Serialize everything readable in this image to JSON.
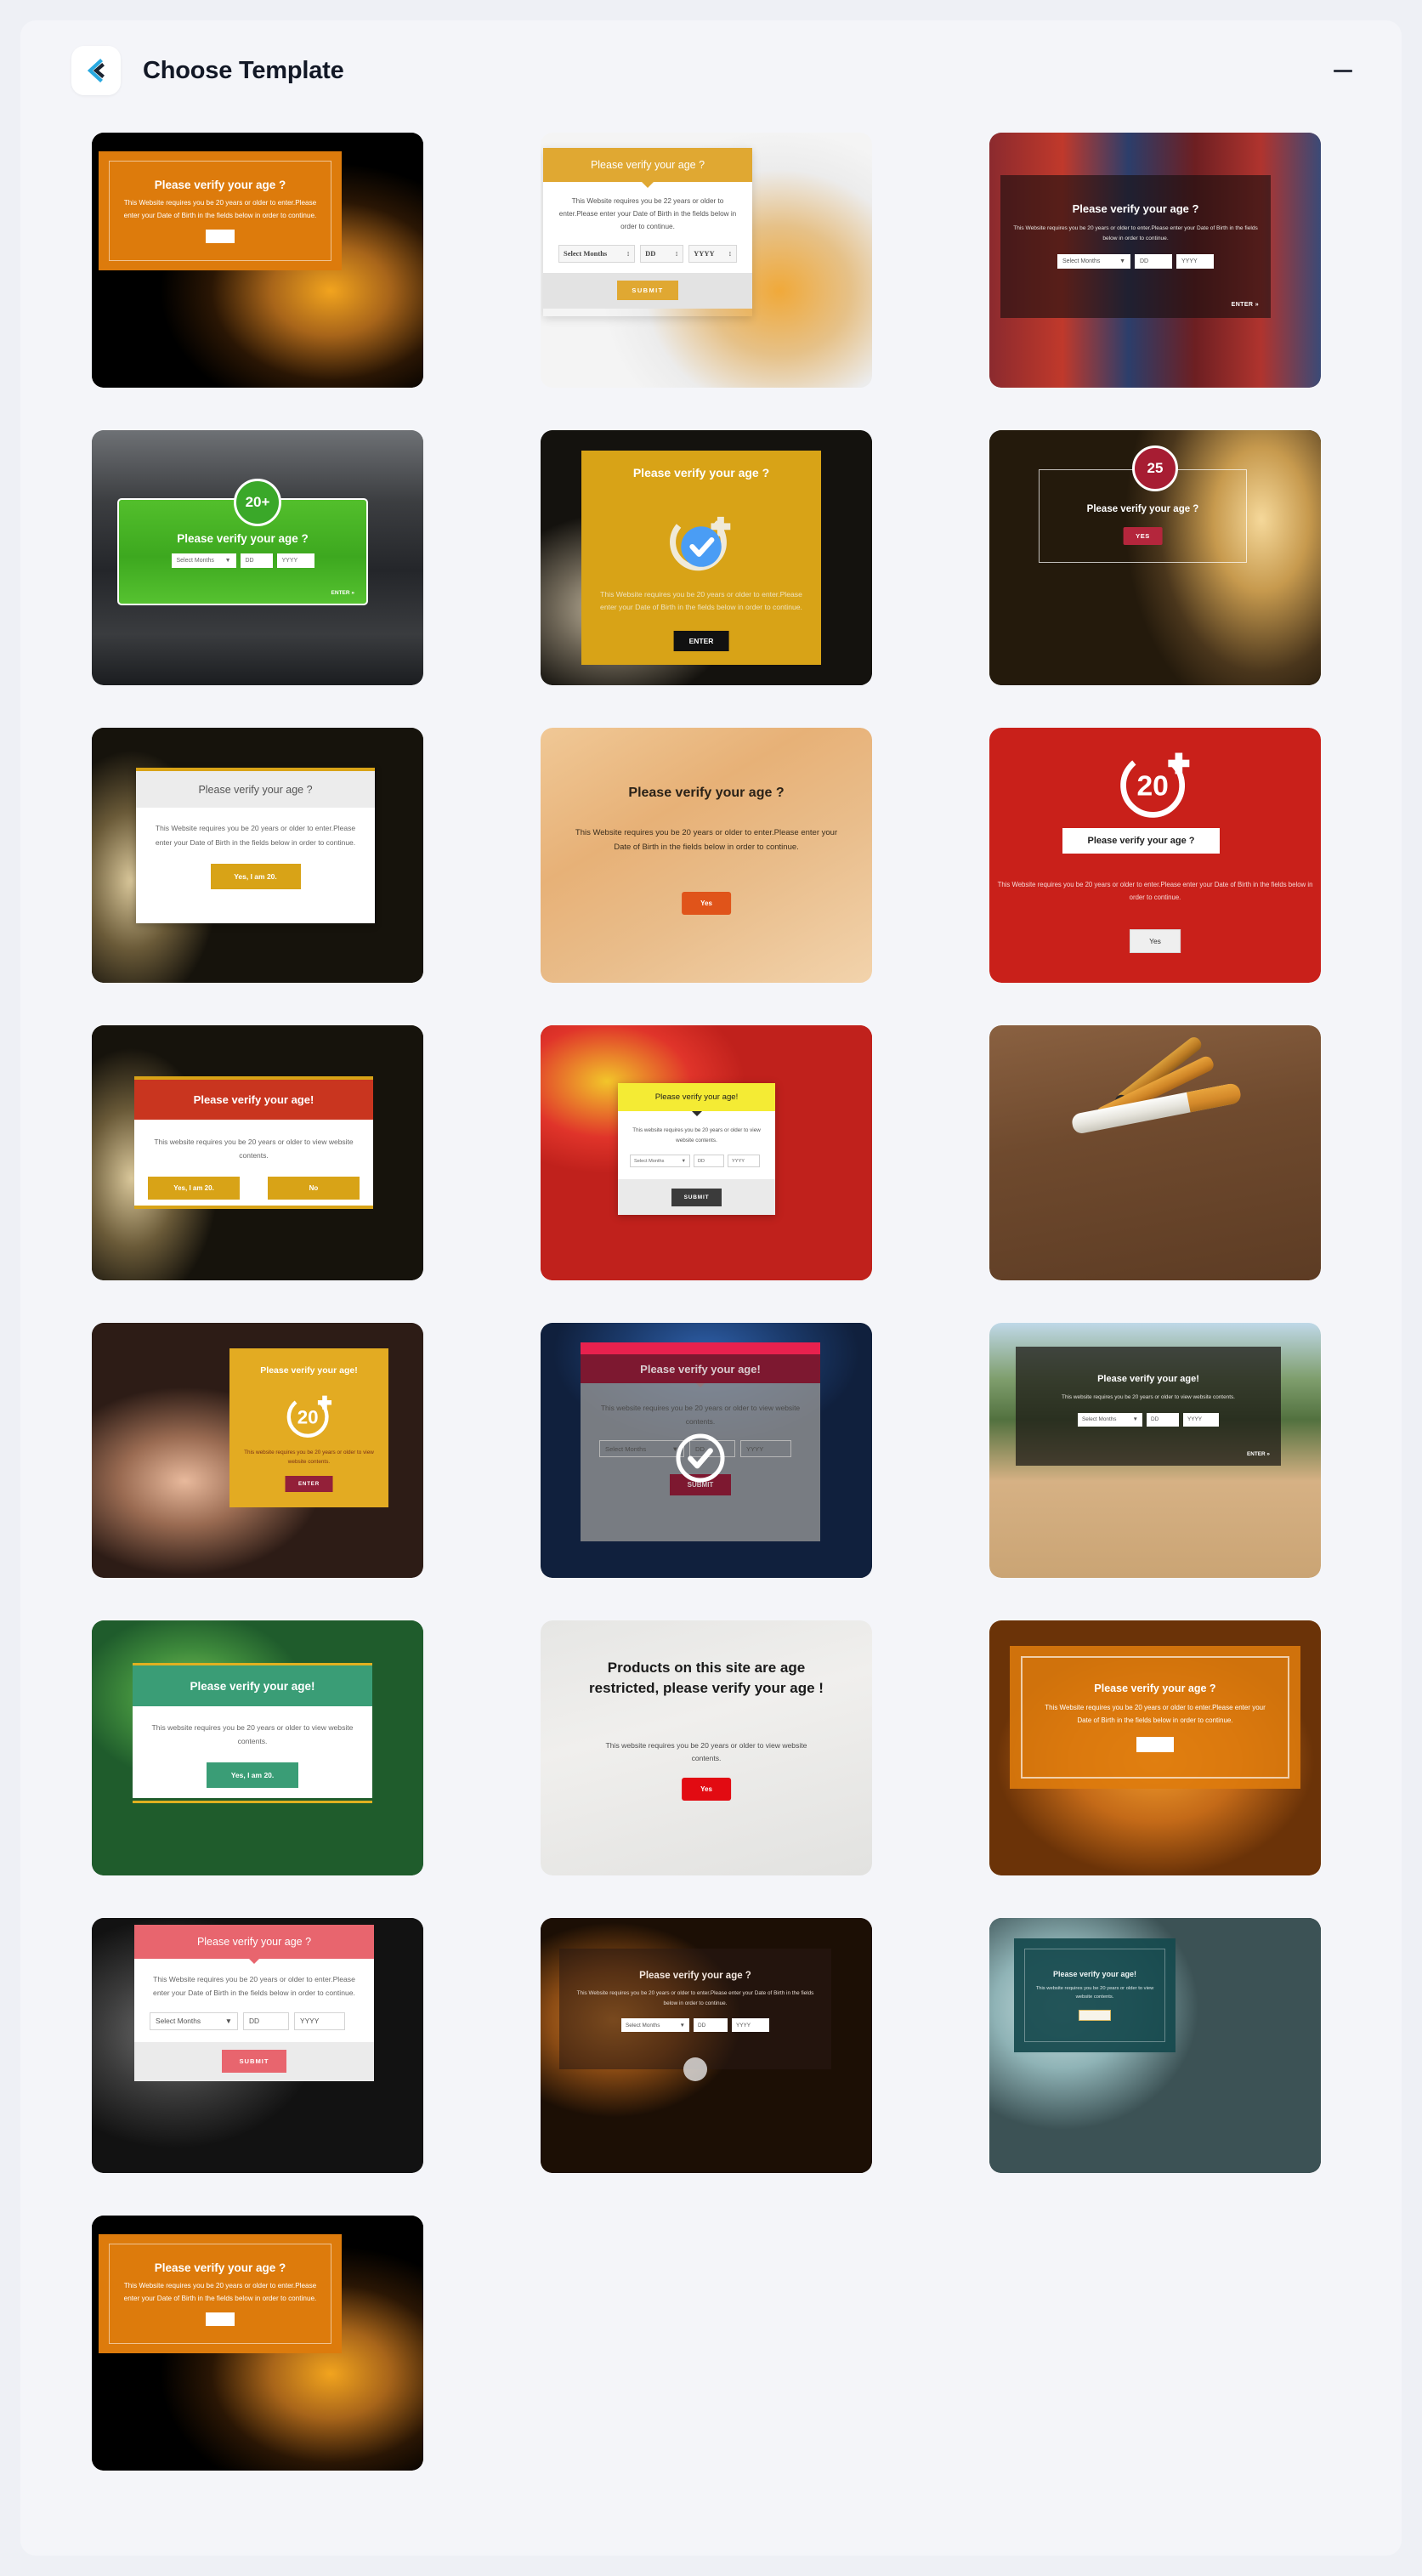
{
  "header": {
    "title": "Choose Template",
    "logo_icon": "kaira-logo-icon",
    "minimize_icon": "minimize-icon",
    "minimize_label": "—"
  },
  "common": {
    "title_question": "Please verify your age ?",
    "title_exclaim": "Please verify your age!",
    "body_dob_20": "This Website requires you be 20 years or older to enter.Please enter your Date of Birth in the fields below in order to continue.",
    "body_dob_22": "This Website requires you be 22 years or older to enter.Please enter your Date of Birth in the fields below in order to continue.",
    "body_contents_20": "This website requires you be 20 years or older to view website contents.",
    "select_months": "Select Months",
    "dd": "DD",
    "yyyy": "YYYY",
    "submit": "SUBMIT",
    "enter": "ENTER",
    "enter_arrow": "ENTER »",
    "yes": "Yes",
    "yes_upper": "YES",
    "no": "No",
    "yes_i_am_20": "Yes, I am 20.",
    "badge_20plus": "20+",
    "badge_25": "25",
    "badge_20": "20",
    "plus": "+"
  },
  "colors": {
    "accent_brand": "#29a9e0",
    "orange": "#dd7b0c",
    "gold": "#d8a317",
    "green": "#3aa829",
    "red": "#c9201a",
    "crimson": "#7d1830",
    "pink": "#e8656e",
    "teal": "#16494d",
    "yellow": "#f4eb34"
  },
  "templates": [
    {
      "id": 1,
      "name": "beer-orange-panel",
      "theme": "bg-beer-dark",
      "title": "Please verify your age ?",
      "body": "This Website requires you be 20 years or older to enter.Please enter your Date of Birth in the fields below in order to continue."
    },
    {
      "id": 2,
      "name": "whisky-gold-modal",
      "theme": "bg-whisky-light",
      "title": "Please verify your age ?",
      "body": "This Website requires you be 22 years or older to enter.Please enter your Date of Birth in the fields below in order to continue.",
      "submit": "SUBMIT"
    },
    {
      "id": 3,
      "name": "bar-neon-dark-overlay",
      "theme": "bg-bar-neon",
      "title": "Please verify your age ?",
      "body": "This Website requires you be 20 years or older to enter.Please enter your Date of Birth in the fields below in order to continue.",
      "enter": "ENTER »"
    },
    {
      "id": 4,
      "name": "barrel-green-badge",
      "theme": "bg-barrel",
      "title": "Please verify your age ?",
      "badge": "20+",
      "enter": "ENTER »"
    },
    {
      "id": 5,
      "name": "bottle-gold-check",
      "theme": "bg-bottle-dark",
      "title": "Please verify your age ?",
      "body": "This Website requires you be 20 years or older to enter.Please enter your Date of Birth in the fields below in order to continue.",
      "enter": "ENTER"
    },
    {
      "id": 6,
      "name": "restaurant-25-badge",
      "theme": "bg-restaurant",
      "title": "Please verify your age ?",
      "badge": "25",
      "yes": "YES"
    },
    {
      "id": 7,
      "name": "bottles-light-card",
      "theme": "bg-bottles-blur",
      "title": "Please verify your age ?",
      "body": "This Website requires you be 20 years or older to enter.Please enter your Date of Birth in the fields below in order to continue.",
      "button": "Yes, I am 20."
    },
    {
      "id": 8,
      "name": "pour-wood-plain",
      "theme": "bg-pour-wood",
      "title": "Please verify your age ?",
      "body": "This Website requires you be 20 years or older to enter.Please enter your Date of Birth in the fields below in order to continue.",
      "yes": "Yes"
    },
    {
      "id": 9,
      "name": "red-solid-20plus",
      "theme": "bg-red-solid",
      "title": "Please verify your age ?",
      "body": "This Website requires you be 20 years or older to enter.Please enter your Date of Birth in the fields below in order to continue.",
      "badge": "20",
      "yes": "Yes"
    },
    {
      "id": 10,
      "name": "bottles-red-header",
      "theme": "bg-bottles-blur",
      "title": "Please verify your age!",
      "body": "This website requires you be 20 years or older to view website contents.",
      "yes": "Yes, I am 20.",
      "no": "No"
    },
    {
      "id": 11,
      "name": "candy-yellow-modal",
      "theme": "bg-candy",
      "title": "Please verify your age!",
      "body": "This website requires you be 20 years or older to view website contents.",
      "submit": "SUBMIT"
    },
    {
      "id": 12,
      "name": "cigarette-photo-only",
      "theme": "bg-cigarette",
      "title": "",
      "body": ""
    },
    {
      "id": 13,
      "name": "casino-gold-20plus",
      "theme": "bg-casino",
      "title": "Please verify your age!",
      "body": "This website requires you be 20 years or older to view website contents.",
      "badge": "20",
      "enter": "ENTER"
    },
    {
      "id": 14,
      "name": "car-crimson-check",
      "theme": "bg-car-blue",
      "title": "Please verify your age!",
      "body": "This website requires you be 20 years or older to view website contents.",
      "submit": "SUBMIT"
    },
    {
      "id": 15,
      "name": "car-road-dark-bar",
      "theme": "bg-car-road",
      "title": "Please verify your age!",
      "body": "This website requires you be 20 years or older to view website contents.",
      "enter": "ENTER »"
    },
    {
      "id": 16,
      "name": "green-field-card",
      "theme": "bg-green-field",
      "title": "Please verify your age!",
      "body": "This website requires you be 20 years or older to view website contents.",
      "button": "Yes, I am 20."
    },
    {
      "id": 17,
      "name": "pills-age-restricted",
      "theme": "bg-pills",
      "title": "Products on this site are age restricted, please verify your age !",
      "body": "This website requires you be 20 years or older to view website contents.",
      "yes": "Yes"
    },
    {
      "id": 18,
      "name": "food-orange-panel",
      "theme": "bg-orange-food",
      "title": "Please verify your age ?",
      "body": "This Website requires you be 20 years or older to enter.Please enter your Date of Birth in the fields below in order to continue."
    },
    {
      "id": 19,
      "name": "smoke-pink-modal",
      "theme": "bg-smoke-gray",
      "title": "Please verify your age ?",
      "body": "This Website requires you be 20 years or older to enter.Please enter your Date of Birth in the fields below in order to continue.",
      "submit": "SUBMIT"
    },
    {
      "id": 20,
      "name": "bar-warm-overlay",
      "theme": "bg-bar-warm",
      "title": "Please verify your age ?",
      "body": "This Website requires you be 20 years or older to enter.Please enter your Date of Birth in the fields below in order to continue."
    },
    {
      "id": 21,
      "name": "smoke-teal-panel",
      "theme": "bg-smoke-teal",
      "title": "Please verify your age!",
      "body": "This website requires you be 20 years or older to view website contents."
    },
    {
      "id": 22,
      "name": "beer-orange-panel-2",
      "theme": "bg-beer-dark",
      "title": "Please verify your age ?",
      "body": "This Website requires you be 20 years or older to enter.Please enter your Date of Birth in the fields below in order to continue."
    }
  ]
}
